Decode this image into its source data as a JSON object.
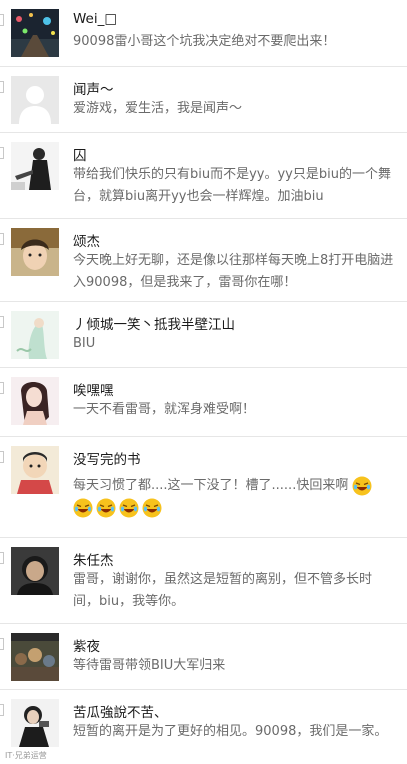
{
  "comments": [
    {
      "name": "Wei_□",
      "text": "90098雷小哥这个坑我决定绝对不要爬出来！"
    },
    {
      "name": "闻声～",
      "text": "爱游戏，爱生活，我是闻声～"
    },
    {
      "name": "囚",
      "text": "带给我们快乐的只有biu而不是yy。yy只是biu的一个舞台，就算biu离开yy也会一样辉煌。加油biu"
    },
    {
      "name": "颂杰",
      "text": "今天晚上好无聊，还是像以往那样每天晚上8打开电脑进入90098，但是我来了，雷哥你在哪！"
    },
    {
      "name": "丿倾城一笑丶抵我半壁江山",
      "text": "BIU"
    },
    {
      "name": "唉嘿嘿",
      "text": "一天不看雷哥，就浑身难受啊！"
    },
    {
      "name": "没写完的书",
      "text": "每天习惯了都....这一下没了！槽了......快回来啊"
    },
    {
      "name": "朱任杰",
      "text": "雷哥，谢谢你，虽然这是短暂的离别，但不管多长时间，biu，我等你。"
    },
    {
      "name": "紫夜",
      "text": "等待雷哥带领BIU大军归来"
    },
    {
      "name": "苦瓜強說不苦、",
      "text": "短暂的离开是为了更好的相见。90098，我们是一家。"
    }
  ],
  "emoji_name": "laughing-tears-emoji",
  "watermark": "IT·兄弟运营",
  "colors": {
    "divider": "#e6e6e6",
    "name": "#1a1a1a",
    "text": "#6a6a6a"
  }
}
